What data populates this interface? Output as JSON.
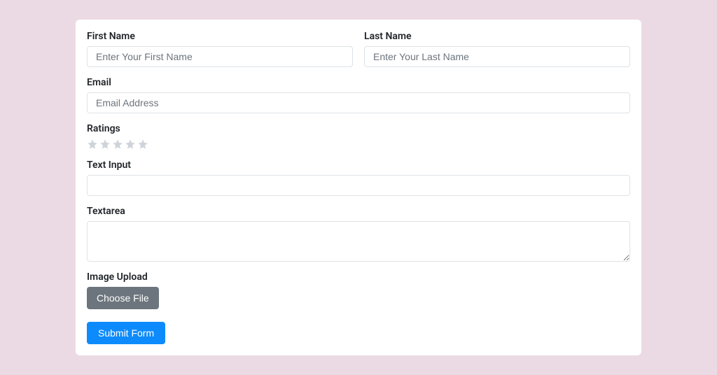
{
  "form": {
    "first_name": {
      "label": "First Name",
      "placeholder": "Enter Your First Name",
      "value": ""
    },
    "last_name": {
      "label": "Last Name",
      "placeholder": "Enter Your Last Name",
      "value": ""
    },
    "email": {
      "label": "Email",
      "placeholder": "Email Address",
      "value": ""
    },
    "ratings": {
      "label": "Ratings",
      "value": 0,
      "max": 5
    },
    "text_input": {
      "label": "Text Input",
      "value": ""
    },
    "textarea": {
      "label": "Textarea",
      "value": ""
    },
    "image_upload": {
      "label": "Image Upload",
      "button": "Choose File"
    },
    "submit": {
      "label": "Submit Form"
    }
  }
}
